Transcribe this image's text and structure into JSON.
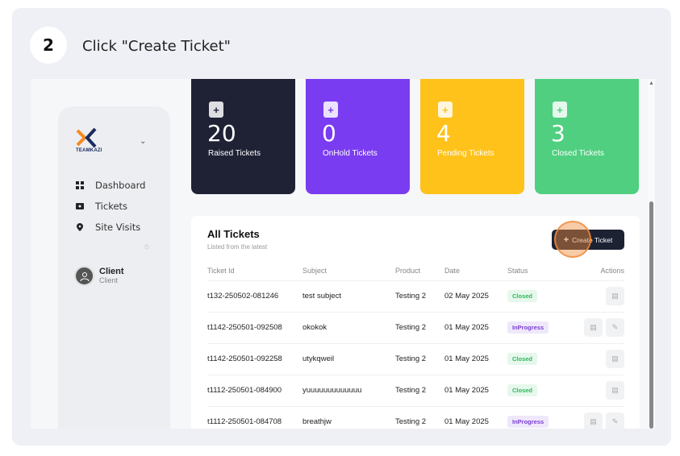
{
  "step": {
    "number": "2",
    "instruction": "Click \"Create Ticket\""
  },
  "app": {
    "logo_text": "TEAMKAZI"
  },
  "sidebar": {
    "items": [
      {
        "label": "Dashboard",
        "icon": "grid-icon"
      },
      {
        "label": "Tickets",
        "icon": "ticket-icon"
      },
      {
        "label": "Site Visits",
        "icon": "location-pin-icon"
      }
    ],
    "user": {
      "name": "Client",
      "role": "Client"
    }
  },
  "stats": [
    {
      "value": "20",
      "label": "Raised Tickets",
      "color": "#1f2235"
    },
    {
      "value": "0",
      "label": "OnHold Tickets",
      "color": "#7a3cf0"
    },
    {
      "value": "4",
      "label": "Pending Tickets",
      "color": "#ffc21a"
    },
    {
      "value": "3",
      "label": "Closed Tickets",
      "color": "#4fcf7f"
    }
  ],
  "tickets": {
    "title": "All Tickets",
    "subtitle": "Listed from the latest",
    "create_label": "Create Ticket",
    "columns": [
      "Ticket Id",
      "Subject",
      "Product",
      "Date",
      "Status",
      "Actions"
    ],
    "rows": [
      {
        "id": "t132-250502-081246",
        "subject": "test subject",
        "product": "Testing 2",
        "date": "02 May 2025",
        "status": "Closed"
      },
      {
        "id": "t1142-250501-092508",
        "subject": "okokok",
        "product": "Testing 2",
        "date": "01 May 2025",
        "status": "InProgress"
      },
      {
        "id": "t1142-250501-092258",
        "subject": "utykqweil",
        "product": "Testing 2",
        "date": "01 May 2025",
        "status": "Closed"
      },
      {
        "id": "t1112-250501-084900",
        "subject": "yuuuuuuuuuuuuu",
        "product": "Testing 2",
        "date": "01 May 2025",
        "status": "Closed"
      },
      {
        "id": "t1112-250501-084708",
        "subject": "breathjw",
        "product": "Testing 2",
        "date": "01 May 2025",
        "status": "InProgress"
      }
    ]
  }
}
